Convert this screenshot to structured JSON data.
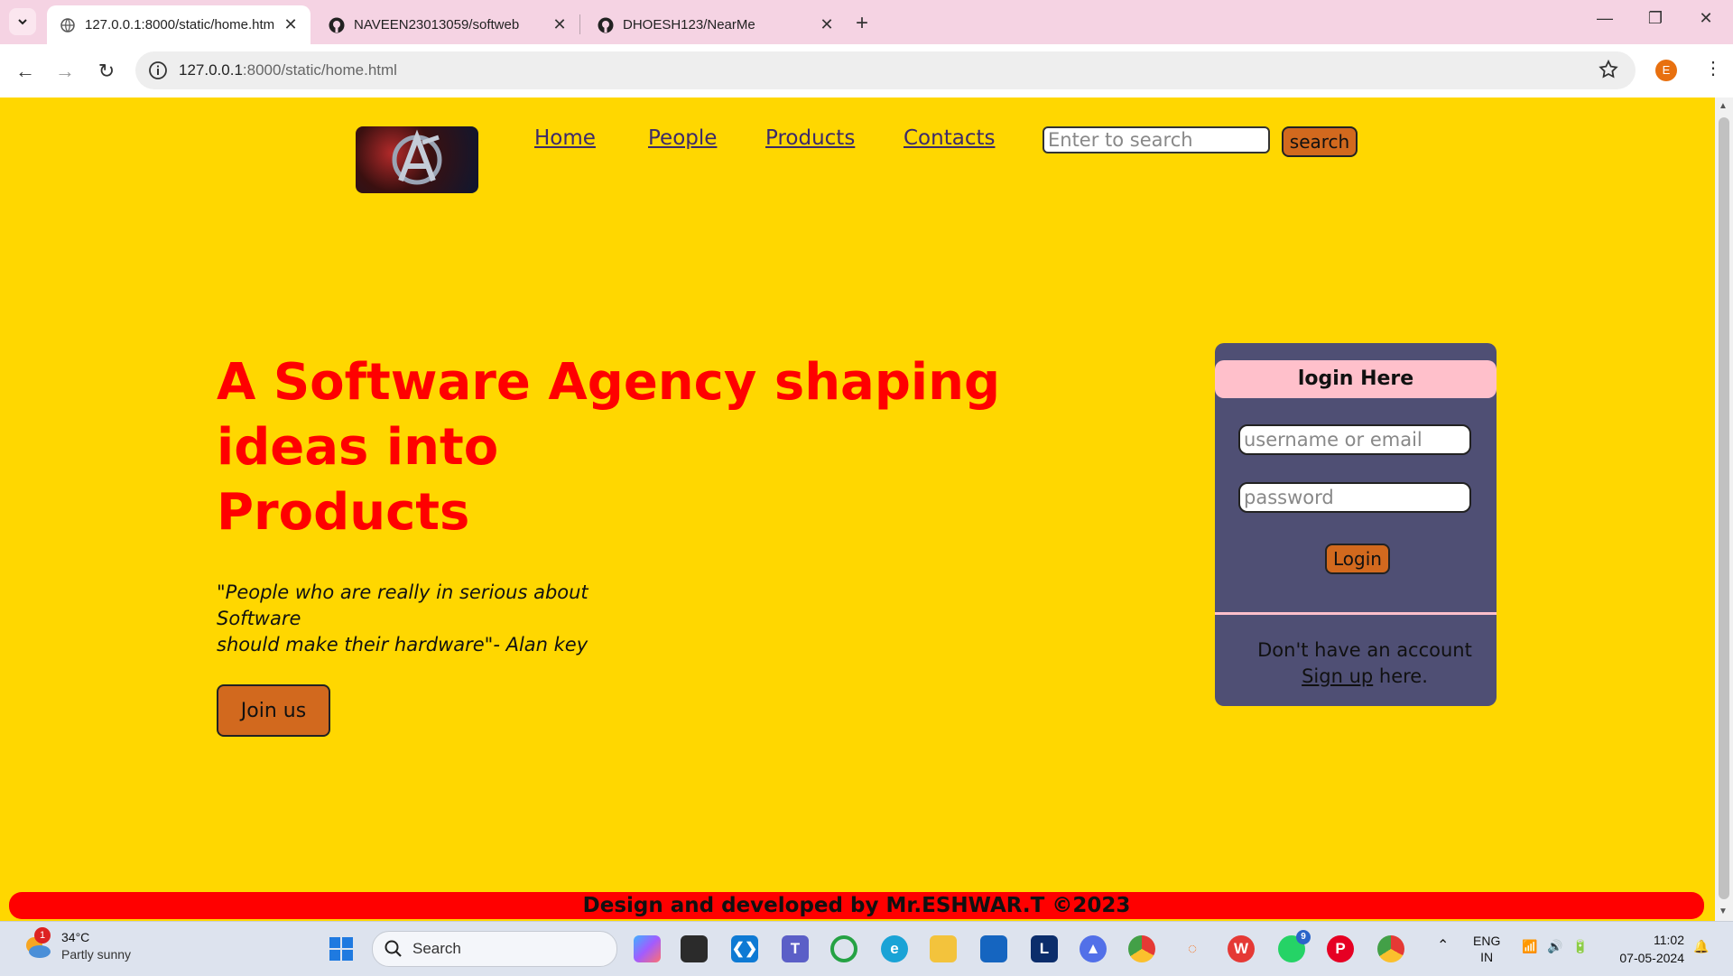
{
  "browser": {
    "tabs": [
      {
        "title": "127.0.0.1:8000/static/home.htm",
        "active": true
      },
      {
        "title": "NAVEEN23013059/softweb",
        "active": false
      },
      {
        "title": "DHOESH123/NearMe",
        "active": false
      }
    ],
    "new_tab_label": "+",
    "url_host": "127.0.0.1",
    "url_path": ":8000/static/home.html",
    "profile_initial": "E"
  },
  "site": {
    "nav": {
      "links": [
        {
          "label": "Home"
        },
        {
          "label": "People"
        },
        {
          "label": "Products"
        },
        {
          "label": "Contacts"
        }
      ],
      "search_placeholder": "Enter to search",
      "search_button": "search"
    },
    "hero": {
      "title_line1": "A Software Agency shaping",
      "title_line2": "ideas into",
      "title_line3": "Products",
      "quote_line1": "\"People who are really in serious about Software",
      "quote_line2": "should make their hardware\"- Alan key",
      "cta": "Join us"
    },
    "login": {
      "heading": "login Here",
      "username_placeholder": "username or email",
      "password_placeholder": "password",
      "button": "Login",
      "signup_prefix": "Don't have an account",
      "signup_link": "Sign up",
      "signup_suffix": " here."
    },
    "footer": "Design and developed by Mr.ESHWAR.T ©2023"
  },
  "taskbar": {
    "weather_temp": "34°C",
    "weather_desc": "Partly sunny",
    "weather_badge": "1",
    "search_label": "Search",
    "teams_badge": "9",
    "language_line1": "ENG",
    "language_line2": "IN",
    "time": "11:02",
    "date": "07-05-2024",
    "apps": [
      "copilot",
      "terminal",
      "vscode",
      "teams",
      "loading-app",
      "edge",
      "file-explorer",
      "store",
      "l-app",
      "vpn",
      "chrome",
      "jupyter",
      "wps",
      "whatsapp",
      "pinterest",
      "chrome-profile"
    ]
  },
  "colors": {
    "page_bg": "#ffd700",
    "accent_red": "#ff0000",
    "button_orange": "#d2691e",
    "login_card": "#4f4f74",
    "login_header": "#ffc0cb"
  }
}
